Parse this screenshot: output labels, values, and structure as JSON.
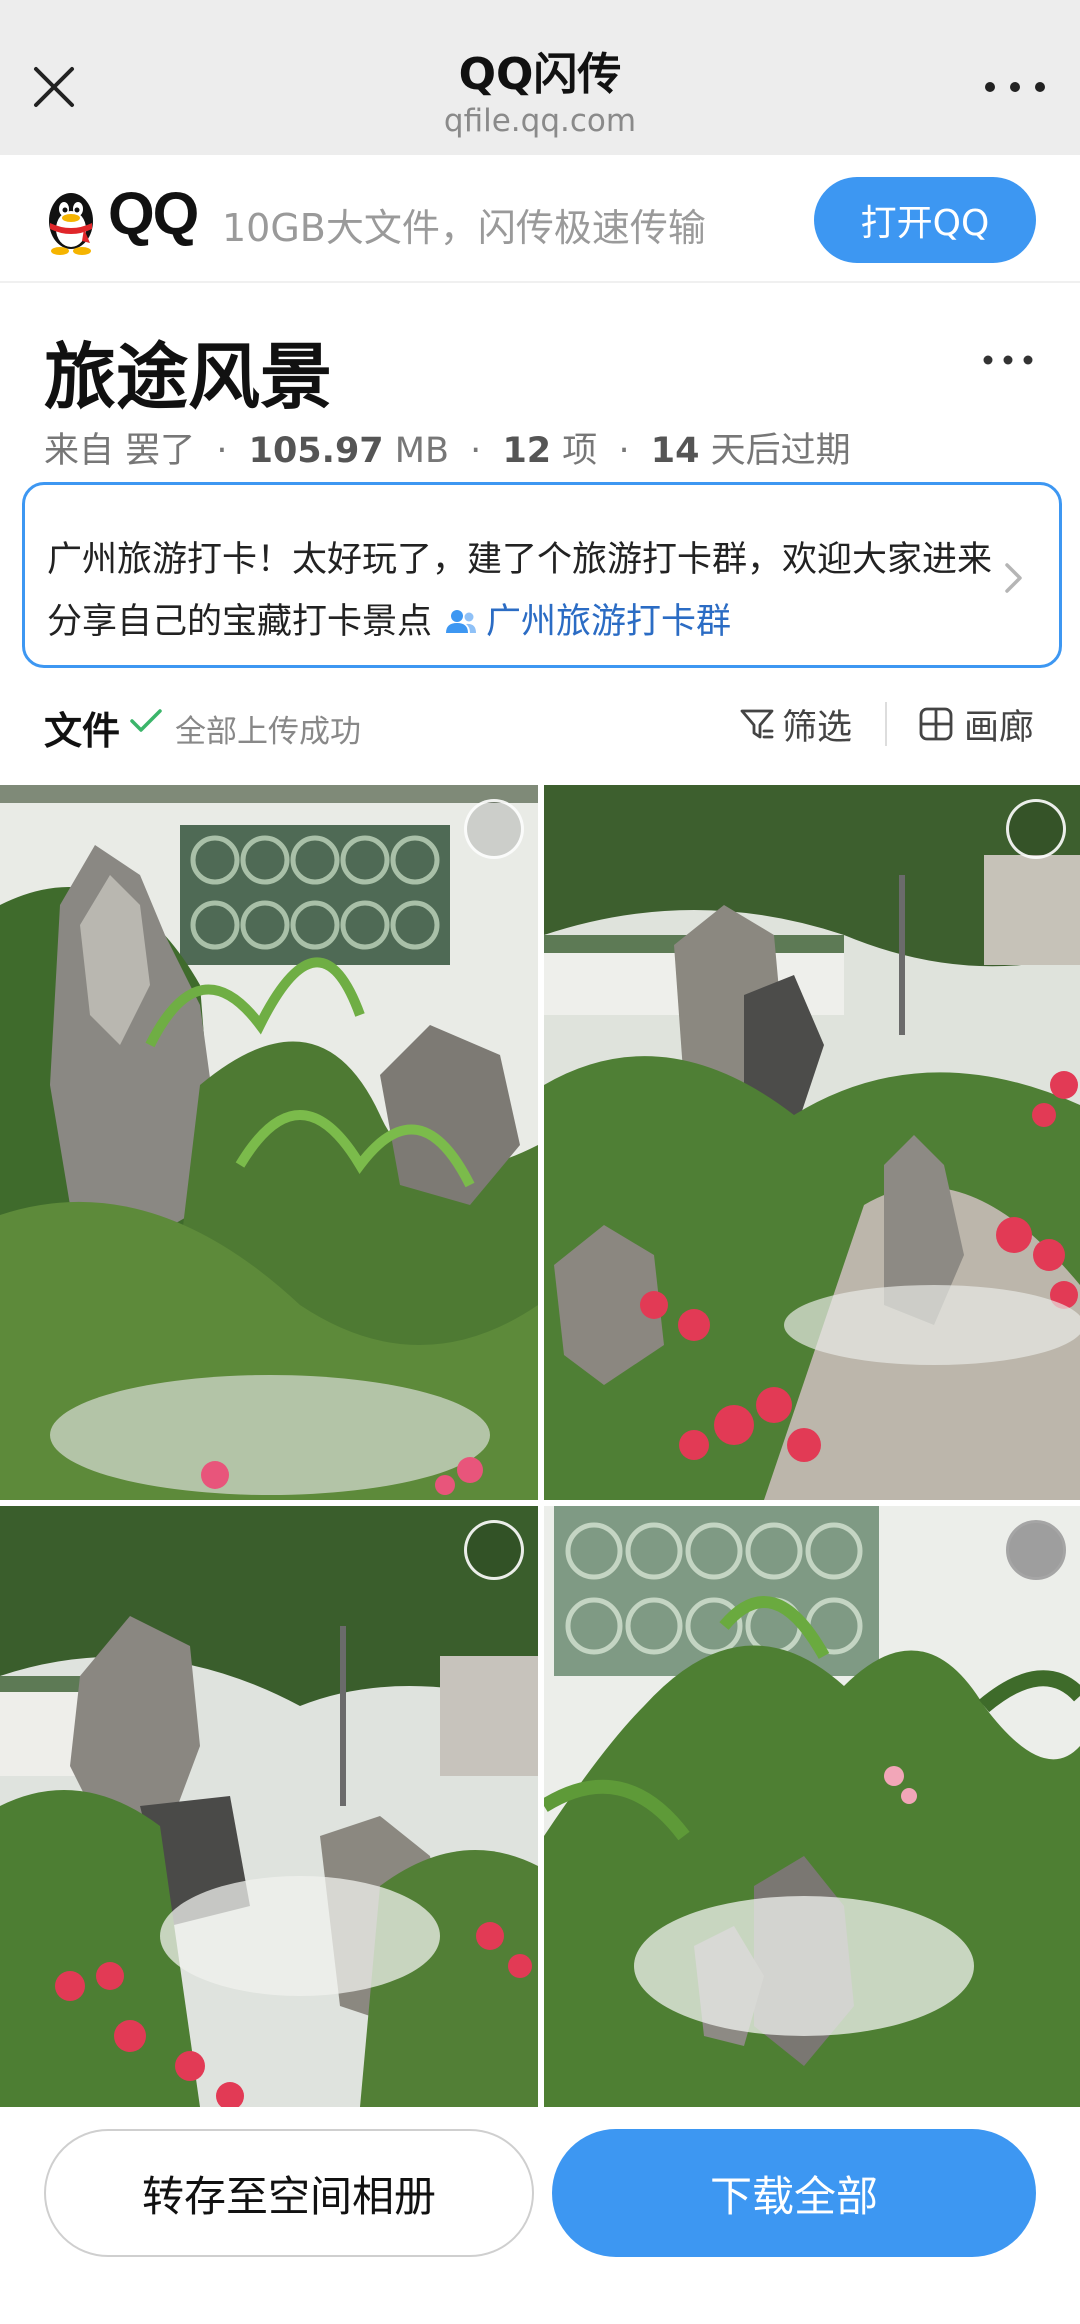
{
  "browser": {
    "title": "QQ闪传",
    "domain": "qfile.qq.com"
  },
  "banner": {
    "brand": "QQ",
    "slogan": "10GB大文件，闪传极速传输",
    "open_button": "打开QQ"
  },
  "share": {
    "title": "旅途风景",
    "from_label": "来自",
    "sender": "罢了",
    "size": "105.97",
    "size_unit": "MB",
    "count": "12",
    "count_unit": "项",
    "expire_days": "14",
    "expire_suffix": "天后过期",
    "separator": "·",
    "description": "广州旅游打卡！太好玩了，建了个旅游打卡群，欢迎大家进来分享自己的宝藏打卡景点",
    "group_name": "广州旅游打卡群"
  },
  "files_bar": {
    "label": "文件",
    "status": "全部上传成功",
    "filter": "筛选",
    "gallery": "画廊"
  },
  "photos": [
    {
      "icon": "garden-rockery-photo"
    },
    {
      "icon": "garden-path-flowers-photo"
    },
    {
      "icon": "garden-mist-rocks-photo"
    },
    {
      "icon": "garden-window-vines-photo"
    }
  ],
  "actions": {
    "save_to_album": "转存至空间相册",
    "download_all": "下载全部"
  },
  "colors": {
    "accent": "#3d97f2",
    "link": "#2b6cc4"
  }
}
